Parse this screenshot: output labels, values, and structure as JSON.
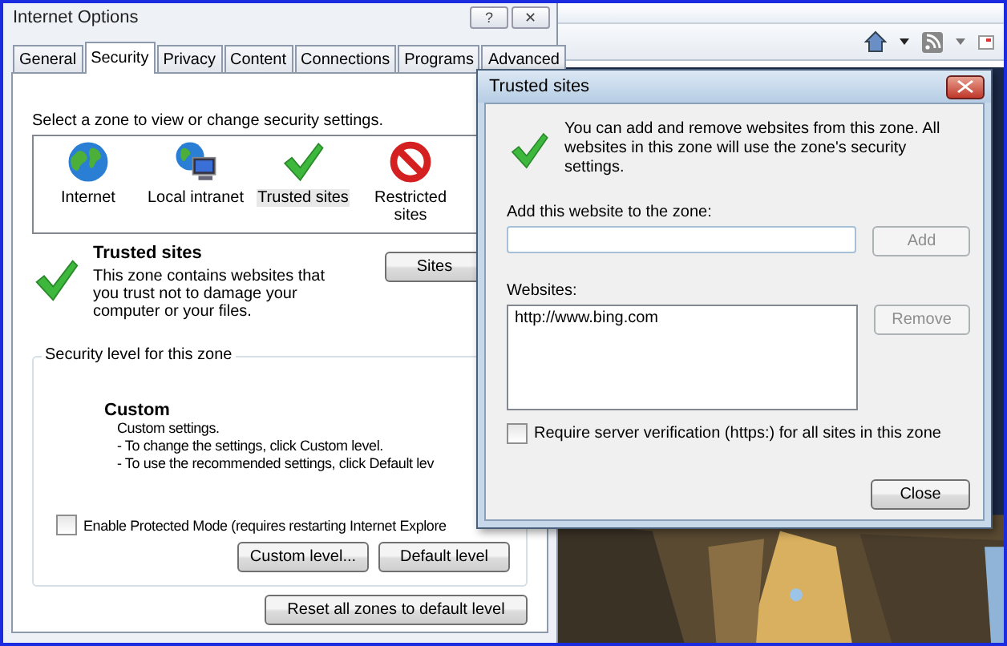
{
  "internet_options": {
    "title": "Internet Options",
    "title_buttons": [
      "?",
      "✕"
    ],
    "tabs": [
      {
        "label": "General",
        "selected": false
      },
      {
        "label": "Security",
        "selected": true
      },
      {
        "label": "Privacy",
        "selected": false
      },
      {
        "label": "Content",
        "selected": false
      },
      {
        "label": "Connections",
        "selected": false
      },
      {
        "label": "Programs",
        "selected": false
      },
      {
        "label": "Advanced",
        "selected": false
      }
    ],
    "zone_prompt": "Select a zone to view or change security settings.",
    "zones": [
      {
        "kind": "globe",
        "label": "Internet",
        "selected": false
      },
      {
        "kind": "intranet",
        "label": "Local intranet",
        "selected": false
      },
      {
        "kind": "check",
        "label": "Trusted sites",
        "selected": true
      },
      {
        "kind": "restricted",
        "label": "Restricted sites",
        "selected": false
      }
    ],
    "zone_title": "Trusted sites",
    "zone_description": "This zone contains websites that you trust not to damage your computer or your files.",
    "sites_button": "Sites",
    "security_group": {
      "label": "Security level for this zone",
      "level_name": "Custom",
      "lines": [
        "Custom settings.",
        "- To change the settings, click Custom level.",
        "- To use the recommended settings, click Default lev"
      ]
    },
    "protected_mode": {
      "label": "Enable Protected Mode (requires restarting Internet Explore",
      "checked": false
    },
    "level_buttons": [
      "Custom level...",
      "Default level"
    ],
    "reset_button": "Reset all zones to default level"
  },
  "trusted_sites_dialog": {
    "title": "Trusted sites",
    "info": "You can add and remove websites from this zone. All websites in this zone will use the zone's security settings.",
    "add_label": "Add this website to the zone:",
    "add_button": {
      "label": "Add",
      "disabled": true
    },
    "websites_label": "Websites:",
    "websites": [
      "http://www.bing.com"
    ],
    "remove_button": {
      "label": "Remove",
      "disabled": true
    },
    "require_https": {
      "label": "Require server verification (https:) for all sites in this zone",
      "checked": false
    },
    "close_button": "Close"
  }
}
